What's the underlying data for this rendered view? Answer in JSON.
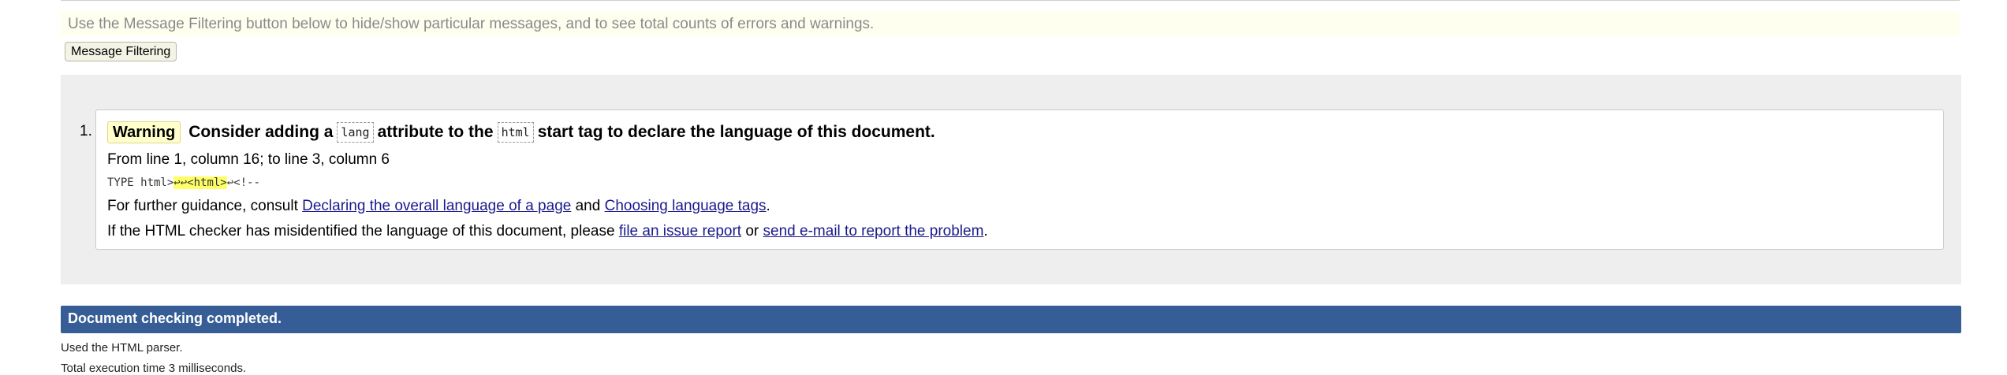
{
  "info": {
    "text": "Use the Message Filtering button below to hide/show particular messages, and to see total counts of errors and warnings."
  },
  "filter_button": {
    "label": "Message Filtering"
  },
  "messages": [
    {
      "number": "1.",
      "type_label": "Warning",
      "title_part1": "Consider adding a",
      "code1": "lang",
      "title_part2": "attribute to the",
      "code2": "html",
      "title_part3": "start tag to declare the language of this document.",
      "location": "From line 1, column 16; to line 3, column 6",
      "extract_before": "TYPE html>",
      "extract_highlight": "↩↩<html>",
      "extract_after": "↩<!--",
      "guidance_prefix": "For further guidance, consult",
      "guidance_link1": "Declaring the overall language of a page",
      "guidance_and": "and",
      "guidance_link2": "Choosing language tags",
      "guidance_suffix": ".",
      "report_prefix": "If the HTML checker has misidentified the language of this document, please",
      "report_link1": "file an issue report",
      "report_or": "or",
      "report_link2": "send e-mail to report the problem",
      "report_suffix": "."
    }
  ],
  "status": {
    "completed": "Document checking completed."
  },
  "footer": {
    "parser": "Used the HTML parser.",
    "time": "Total execution time 3 milliseconds."
  },
  "colors": {
    "info_bg": "#fffff0",
    "panel_bg": "#eeeeee",
    "warning_bg": "#ffffcc",
    "completed_bg": "#365d95",
    "link": "#1a1a8c"
  }
}
